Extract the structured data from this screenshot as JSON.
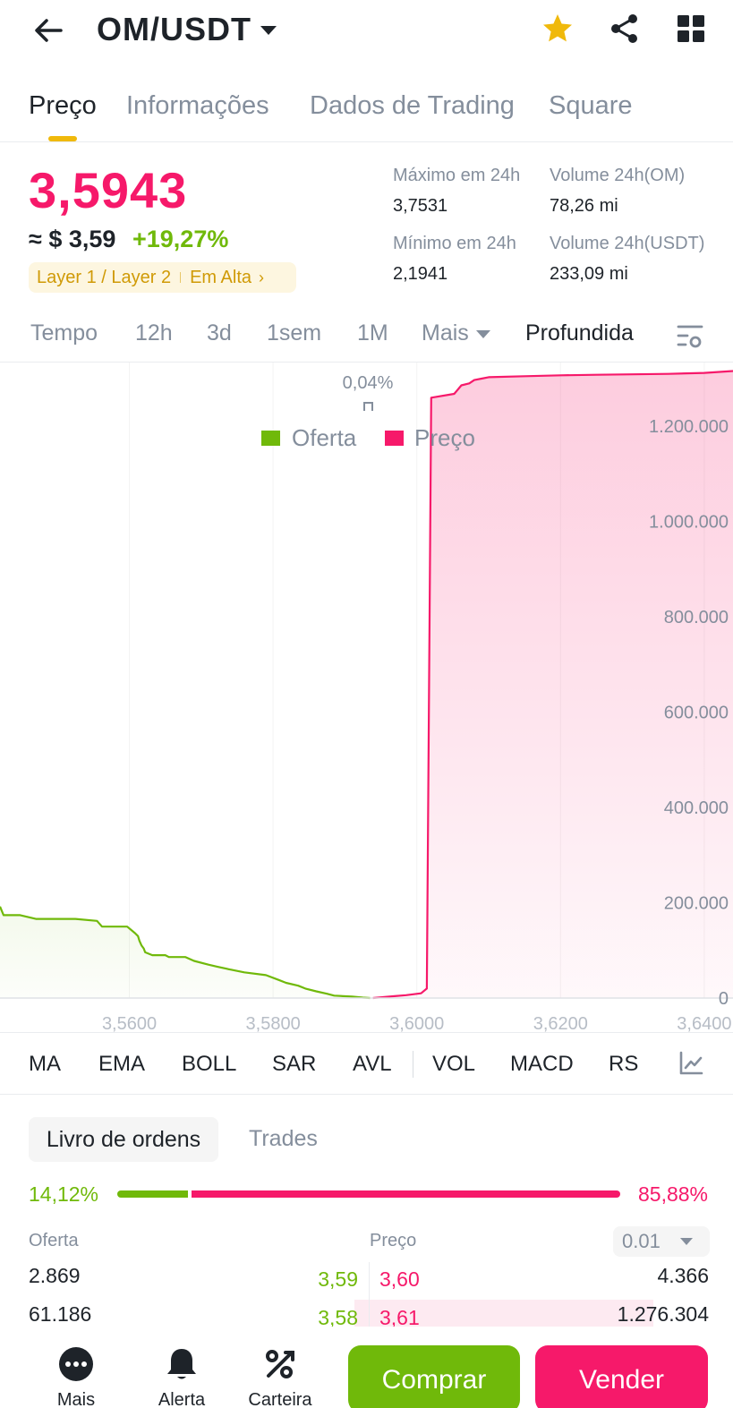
{
  "header": {
    "pair": "OM/USDT"
  },
  "tabs": [
    {
      "label": "Preço",
      "active": true
    },
    {
      "label": "Informações"
    },
    {
      "label": "Dados de Trading"
    },
    {
      "label": "Square"
    }
  ],
  "ticker": {
    "last_price": "3,5943",
    "usd_price": "≈ $ 3,59",
    "change": "+19,27%",
    "tag_1": "Layer 1 / Layer 2",
    "tag_2": "Em Alta",
    "high_label": "Máximo em 24h",
    "high_value": "3,7531",
    "low_label": "Mínimo em 24h",
    "low_value": "2,1941",
    "vol_om_label": "Volume 24h(OM)",
    "vol_om_value": "78,26 mi",
    "vol_usdt_label": "Volume 24h(USDT)",
    "vol_usdt_value": "233,09 mi"
  },
  "time_row": {
    "items": [
      "Tempo",
      "12h",
      "3d",
      "1sem",
      "1M",
      "Mais"
    ],
    "active": "Profundida"
  },
  "colors": {
    "bid": "#70b90a",
    "ask": "#f6196a",
    "accent": "#f0b90b"
  },
  "chart_data": {
    "type": "area",
    "spread_label": "0,04%",
    "legend": [
      {
        "name": "Oferta",
        "color": "#70b90a"
      },
      {
        "name": "Preço",
        "color": "#f6196a"
      }
    ],
    "xlim": [
      3.542,
      3.644
    ],
    "ylim": [
      0,
      1300000
    ],
    "x_ticks": [
      "3,5600",
      "3,5800",
      "3,6000",
      "3,6200",
      "3,6400"
    ],
    "y_ticks": [
      "1.200.000",
      "1.000.000",
      "800.000",
      "600.000",
      "400.000",
      "200.000",
      "0"
    ],
    "series": [
      {
        "name": "Oferta",
        "x": [
          3.542,
          3.5425,
          3.5448,
          3.547,
          3.5515,
          3.5525,
          3.5555,
          3.5562,
          3.5597,
          3.5608,
          3.5612,
          3.5614,
          3.5617,
          3.562,
          3.5622,
          3.5632,
          3.565,
          3.5655,
          3.5678,
          3.569,
          3.571,
          3.5722,
          3.574,
          3.576,
          3.579,
          3.5808,
          3.5818,
          3.5835,
          3.5845,
          3.586,
          3.5875,
          3.5885,
          3.591,
          3.5925,
          3.5935
        ],
        "y": [
          192000,
          174000,
          174000,
          166000,
          166000,
          166000,
          162000,
          150000,
          150000,
          136000,
          130000,
          120000,
          110000,
          104000,
          96000,
          90000,
          90000,
          86000,
          86000,
          78000,
          70000,
          66000,
          60000,
          54000,
          48000,
          38000,
          32000,
          26000,
          20000,
          14000,
          9000,
          5000,
          3000,
          1000,
          0
        ]
      },
      {
        "name": "Preço",
        "x": [
          3.5939,
          3.5969,
          3.5985,
          3.6006,
          3.6014,
          3.602,
          3.6052,
          3.6062,
          3.6073,
          3.608,
          3.609,
          3.61,
          3.615,
          3.62,
          3.625,
          3.63,
          3.635,
          3.64,
          3.644
        ],
        "y": [
          0,
          4000,
          6000,
          10000,
          20000,
          1260000,
          1268000,
          1286000,
          1290000,
          1297000,
          1300000,
          1303000,
          1305000,
          1307000,
          1308000,
          1309000,
          1310000,
          1312000,
          1316000
        ]
      }
    ]
  },
  "indicators": [
    "MA",
    "EMA",
    "BOLL",
    "SAR",
    "AVL",
    "VOL",
    "MACD",
    "RSI"
  ],
  "order_book": {
    "tab_active": "Livro de ordens",
    "tab_other": "Trades",
    "bid_ratio": "14,12%",
    "ask_ratio": "85,88%",
    "bid_fraction": 0.1412,
    "col_bid": "Oferta",
    "col_price": "Preço",
    "precision": "0.01",
    "rows": [
      {
        "bid_qty": "2.869",
        "bid_price": "3,59",
        "ask_price": "3,60",
        "ask_qty": "4.366"
      },
      {
        "bid_qty": "61.186",
        "bid_price": "3,58",
        "ask_price": "3,61",
        "ask_qty": "1.276.304"
      }
    ]
  },
  "bottom_nav": {
    "more": "Mais",
    "alert": "Alerta",
    "wallet": "Carteira",
    "buy": "Comprar",
    "sell": "Vender"
  }
}
